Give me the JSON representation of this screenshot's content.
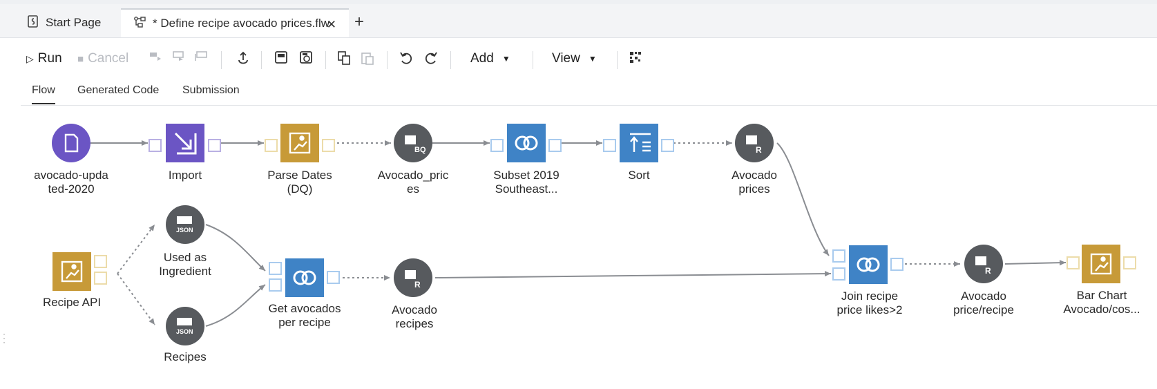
{
  "tabs": [
    {
      "label": "Start Page",
      "icon": "start-page-icon"
    },
    {
      "label": "* Define recipe avocado prices.flw",
      "icon": "flow-icon"
    }
  ],
  "toolbar": {
    "run": "Run",
    "cancel": "Cancel",
    "add": "Add",
    "view": "View"
  },
  "subtabs": [
    "Flow",
    "Generated Code",
    "Submission"
  ],
  "nodes": {
    "source": [
      "avocado-upda",
      "ted-2020"
    ],
    "import": [
      "Import"
    ],
    "parse_dates": [
      "Parse Dates",
      "(DQ)"
    ],
    "avocado_prices_bq": [
      "Avocado_pric",
      "es"
    ],
    "subset": [
      "Subset 2019",
      "Southeast..."
    ],
    "sort": [
      "Sort"
    ],
    "avocado_prices_r": [
      "Avocado",
      "prices"
    ],
    "recipe_api": [
      "Recipe API"
    ],
    "used_as": [
      "Used as",
      "Ingredient"
    ],
    "recipes": [
      "Recipes"
    ],
    "get_avocados": [
      "Get avocados",
      "per recipe"
    ],
    "avocado_recipes": [
      "Avocado",
      "recipes"
    ],
    "join": [
      "Join recipe",
      "price likes>2"
    ],
    "price_recipe": [
      "Avocado",
      "price/recipe"
    ],
    "bar_chart": [
      "Bar Chart",
      "Avocado/cos..."
    ]
  },
  "node_badges": {
    "bq": "BQ",
    "r": "R",
    "json": "JSON"
  },
  "colors": {
    "purple": "#6b55c4",
    "gold": "#c79a38",
    "blue": "#3f83c6",
    "gray": "#575a5e"
  }
}
